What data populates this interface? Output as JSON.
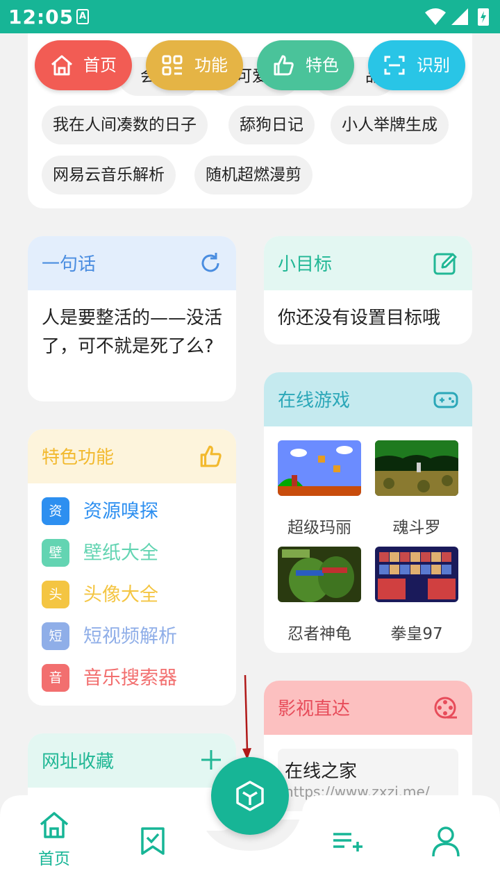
{
  "status_bar": {
    "time": "12:05",
    "input_indicator": "A"
  },
  "top_nav": [
    {
      "label": "首页",
      "icon": "home-icon",
      "color": "#f25c54"
    },
    {
      "label": "功能",
      "icon": "grid-icon",
      "color": "#e5b445"
    },
    {
      "label": "特色",
      "icon": "thumbs-up-icon",
      "color": "#4ac39a"
    },
    {
      "label": "识别",
      "icon": "scan-icon",
      "color": "#29c5e6"
    }
  ],
  "tag_cloud": {
    "partial_tags": [
      "会",
      "可爱",
      "品头"
    ],
    "tags": [
      "我在人间凑数的日子",
      "舔狗日记",
      "小人举牌生成",
      "网易云音乐解析",
      "随机超燃漫剪"
    ]
  },
  "sentence_card": {
    "title": "一句话",
    "text": "人是要整活的——没活了，可不就是死了么?",
    "header_color": "#e3eefc",
    "accent": "#4a8de0"
  },
  "goal_card": {
    "title": "小目标",
    "text": "你还没有设置目标哦",
    "header_color": "#e3f7f2",
    "accent": "#21b795"
  },
  "features_card": {
    "title": "特色功能",
    "header_color": "#fdf4dc",
    "accent": "#f2b92e",
    "items": [
      {
        "badge": "资",
        "label": "资源嗅探",
        "color": "#2d8ff0"
      },
      {
        "badge": "壁",
        "label": "壁纸大全",
        "color": "#63d4b2"
      },
      {
        "badge": "头",
        "label": "头像大全",
        "color": "#f4c542"
      },
      {
        "badge": "短",
        "label": "短视频解析",
        "color": "#8faee8"
      },
      {
        "badge": "音",
        "label": "音乐搜索器",
        "color": "#f26f6f"
      }
    ]
  },
  "games_card": {
    "title": "在线游戏",
    "header_color": "#c5eaef",
    "accent": "#2ba7b8",
    "games": [
      {
        "name": "超级玛丽"
      },
      {
        "name": "魂斗罗"
      },
      {
        "name": "忍者神龟"
      },
      {
        "name": "拳皇97"
      }
    ]
  },
  "video_card": {
    "title": "影视直达",
    "header_color": "#fcc0c0",
    "accent": "#e74c5a",
    "sites": [
      {
        "name": "在线之家",
        "url": "https://www.zxzj.me/"
      }
    ]
  },
  "bookmarks_card": {
    "title": "网址收藏",
    "header_color": "#e3f7f2",
    "accent": "#21b795"
  },
  "bottom_nav": {
    "items": [
      {
        "label": "首页",
        "icon": "home-icon",
        "active": true
      },
      {
        "label": "",
        "icon": "bookmark-check-icon",
        "active": false
      },
      {
        "label": "",
        "icon": "cube-icon",
        "active": false
      },
      {
        "label": "",
        "icon": "playlist-add-icon",
        "active": false
      },
      {
        "label": "",
        "icon": "user-icon",
        "active": false
      }
    ],
    "active_color": "#17b596"
  }
}
